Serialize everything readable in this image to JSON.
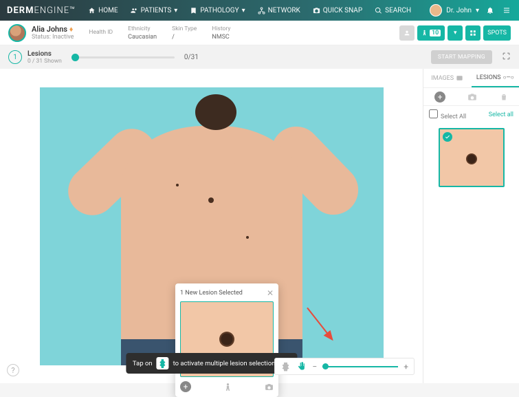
{
  "brand": {
    "a": "DERM",
    "b": "ENGINE"
  },
  "nav": {
    "home": "HOME",
    "patients": "PATIENTS",
    "pathology": "PATHOLOGY",
    "network": "NETWORK",
    "quicksnap": "QUICK SNAP",
    "search": "SEARCH"
  },
  "user": {
    "name": "Dr. John"
  },
  "patient": {
    "name": "Alia Johns",
    "status_lbl": "Status:",
    "status": "Inactive",
    "fields": {
      "healthid": {
        "lbl": "Health ID",
        "val": ""
      },
      "ethnicity": {
        "lbl": "Ethnicity",
        "val": "Caucasian"
      },
      "skintype": {
        "lbl": "Skin Type",
        "val": "/"
      },
      "history": {
        "lbl": "History",
        "val": "NMSC"
      }
    }
  },
  "toolbar": {
    "count": "10",
    "spots": "SPOTS"
  },
  "lesions": {
    "num": "1",
    "title": "Lesions",
    "sub": "0 / 31 Shown",
    "counter": "0/31",
    "startmap": "START MAPPING"
  },
  "popup": {
    "title": "1 New Lesion Selected"
  },
  "toast": {
    "a": "Tap on",
    "b": "to activate multiple lesion selection."
  },
  "sidebar": {
    "tab_images": "IMAGES",
    "tab_lesions": "LESIONS",
    "selectall_lbl": "Select All",
    "selectall_link": "Select all"
  },
  "zoom": {
    "minus": "−",
    "plus": "+"
  },
  "help": "?"
}
